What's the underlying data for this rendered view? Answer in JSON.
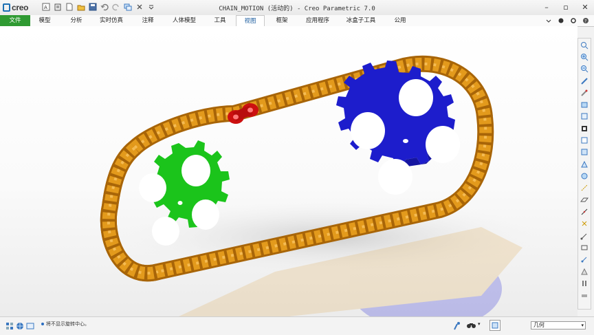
{
  "app": {
    "logo_text": "creo",
    "window_title": "CHAIN_MOTION (活动的) - Creo Parametric 7.0"
  },
  "quick_access": [
    "new-icon",
    "regenerate-icon",
    "new-file-icon",
    "open-icon",
    "save-icon",
    "undo-icon",
    "redo-icon",
    "windows-icon",
    "close-window-icon",
    "customize-icon"
  ],
  "tabs": [
    {
      "label": "文件",
      "active": false,
      "file": true
    },
    {
      "label": "模型",
      "active": false
    },
    {
      "label": "分析",
      "active": false
    },
    {
      "label": "实时仿真",
      "active": false
    },
    {
      "label": "注释",
      "active": false
    },
    {
      "label": "人体模型",
      "active": false
    },
    {
      "label": "工具",
      "active": false
    },
    {
      "label": "视图",
      "active": true
    },
    {
      "label": "框架",
      "active": false
    },
    {
      "label": "应用程序",
      "active": false
    },
    {
      "label": "冰盒子工具",
      "active": false
    },
    {
      "label": "公用",
      "active": false
    }
  ],
  "status_bar": {
    "message": "• 将不显示旋转中心。",
    "message_text": "将不显示旋转中心。",
    "filter_value": "几何"
  },
  "colors": {
    "chain": "#d4890f",
    "chain_dark": "#a86508",
    "small_sprocket": "#1bc41b",
    "large_sprocket": "#1d1dcc",
    "highlight_link": "#cc1010",
    "file_tab": "#2f9a32"
  }
}
